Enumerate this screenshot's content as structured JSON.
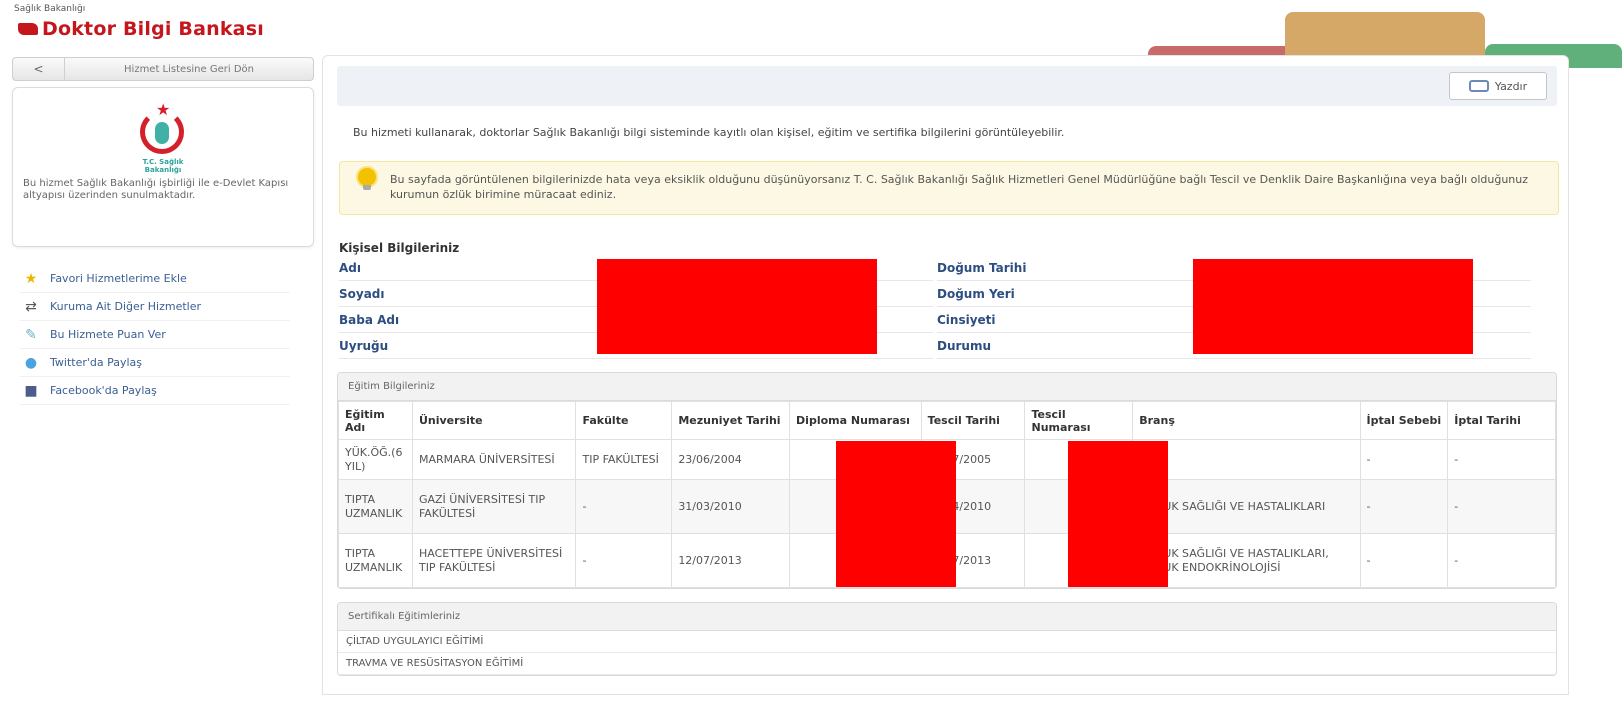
{
  "header": {
    "ministry": "Sağlık Bakanlığı",
    "title": "Doktor Bilgi Bankası"
  },
  "sidebar": {
    "back_label": "Hizmet Listesine Geri Dön",
    "logo_caption": "T.C. Sağlık Bakanlığı",
    "info_text": "Bu hizmet Sağlık Bakanlığı işbirliği ile e-Devlet Kapısı altyapısı üzerinden sunulmaktadır.",
    "links": [
      {
        "label": "Favori Hizmetlerime Ekle",
        "icon": "star-icon"
      },
      {
        "label": "Kuruma Ait Diğer Hizmetler",
        "icon": "arrows-icon"
      },
      {
        "label": "Bu Hizmete Puan Ver",
        "icon": "rate-icon"
      },
      {
        "label": "Twitter'da Paylaş",
        "icon": "twitter-icon"
      },
      {
        "label": "Facebook'da Paylaş",
        "icon": "facebook-icon"
      }
    ]
  },
  "toolbar": {
    "print_label": "Yazdır"
  },
  "intro": "Bu hizmeti kullanarak, doktorlar Sağlık Bakanlığı bilgi sisteminde kayıtlı olan kişisel, eğitim ve sertifika bilgilerini görüntüleyebilir.",
  "alert": "Bu sayfada görüntülenen bilgilerinizde hata veya eksiklik olduğunu düşünüyorsanız T. C. Sağlık Bakanlığı Sağlık Hizmetleri Genel Müdürlüğüne bağlı Tescil ve Denklik Daire Başkanlığına veya bağlı olduğunuz kurumun özlük birimine müracaat ediniz.",
  "personal": {
    "title": "Kişisel Bilgileriniz",
    "left_labels": [
      "Adı",
      "Soyadı",
      "Baba Adı",
      "Uyruğu"
    ],
    "right_labels": [
      "Doğum Tarihi",
      "Doğum Yeri",
      "Cinsiyeti",
      "Durumu"
    ]
  },
  "education": {
    "title": "Eğitim Bilgileriniz",
    "headers": [
      "Eğitim Adı",
      "Üniversite",
      "Fakülte",
      "Mezuniyet Tarihi",
      "Diploma Numarası",
      "Tescil Tarihi",
      "Tescil Numarası",
      "Branş",
      "İptal Sebebi",
      "İptal Tarihi"
    ],
    "rows": [
      [
        "YÜK.ÖĞ.(6 YIL)",
        "MARMARA ÜNİVERSİTESİ",
        "TIP FAKÜLTESİ",
        "23/06/2004",
        "",
        "28/07/2005",
        "",
        "-",
        "-",
        "-"
      ],
      [
        "TIPTA UZMANLIK",
        "GAZİ ÜNİVERSİTESİ TIP FAKÜLTESİ",
        "-",
        "31/03/2010",
        "",
        "06/04/2010",
        "",
        "ÇOCUK SAĞLIĞI VE HASTALIKLARI",
        "-",
        "-"
      ],
      [
        "TIPTA UZMANLIK",
        "HACETTEPE ÜNİVERSİTESİ TIP FAKÜLTESİ",
        "-",
        "12/07/2013",
        "",
        "19/07/2013",
        "",
        "ÇOCUK SAĞLIĞI VE HASTALIKLARI, ÇOCUK ENDOKRİNOLOJİSİ",
        "-",
        "-"
      ]
    ]
  },
  "certificates": {
    "title": "Sertifikalı Eğitimleriniz",
    "items": [
      "ÇİLTAD UYGULAYICI EĞİTİMİ",
      "TRAVMA VE RESÜSİTASYON EĞİTİMİ"
    ]
  },
  "colors": {
    "brand": "#c4161c",
    "link": "#2d4e80",
    "redaction": "#ff0000",
    "alert_bg": "#fcf8e3"
  }
}
